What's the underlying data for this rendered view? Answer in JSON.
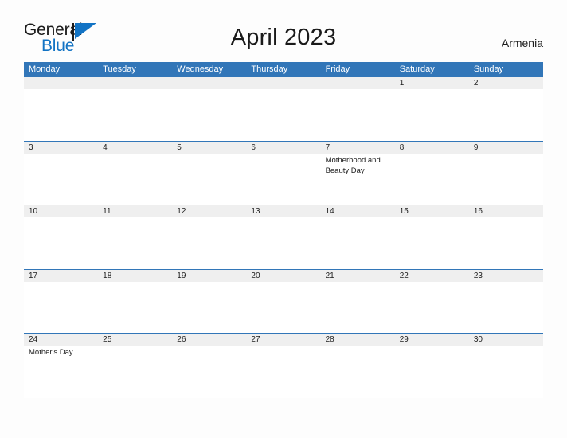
{
  "brand": {
    "word_one": "General",
    "word_two": "Blue",
    "flag_icon": "blue-flag-triangle-icon",
    "flag_color": "#1273c4",
    "text_color": "#1b1b1b"
  },
  "header": {
    "title": "April 2023",
    "locale": "Armenia"
  },
  "colors": {
    "header_blue": "#3276b8",
    "date_strip_gray": "#efefef",
    "row_border_blue": "#3276b8",
    "page_background": "#fdfdfd",
    "text": "#1c1c1c"
  },
  "calendar": {
    "month": "April",
    "year": "2023",
    "weekday_headers": [
      "Monday",
      "Tuesday",
      "Wednesday",
      "Thursday",
      "Friday",
      "Saturday",
      "Sunday"
    ],
    "weeks": [
      {
        "dates": [
          "",
          "",
          "",
          "",
          "",
          "1",
          "2"
        ],
        "events": [
          "",
          "",
          "",
          "",
          "",
          "",
          ""
        ]
      },
      {
        "dates": [
          "3",
          "4",
          "5",
          "6",
          "7",
          "8",
          "9"
        ],
        "events": [
          "",
          "",
          "",
          "",
          "Motherhood and Beauty Day",
          "",
          ""
        ]
      },
      {
        "dates": [
          "10",
          "11",
          "12",
          "13",
          "14",
          "15",
          "16"
        ],
        "events": [
          "",
          "",
          "",
          "",
          "",
          "",
          ""
        ]
      },
      {
        "dates": [
          "17",
          "18",
          "19",
          "20",
          "21",
          "22",
          "23"
        ],
        "events": [
          "",
          "",
          "",
          "",
          "",
          "",
          ""
        ]
      },
      {
        "dates": [
          "24",
          "25",
          "26",
          "27",
          "28",
          "29",
          "30"
        ],
        "events": [
          "Mother's Day",
          "",
          "",
          "",
          "",
          "",
          ""
        ]
      }
    ]
  }
}
